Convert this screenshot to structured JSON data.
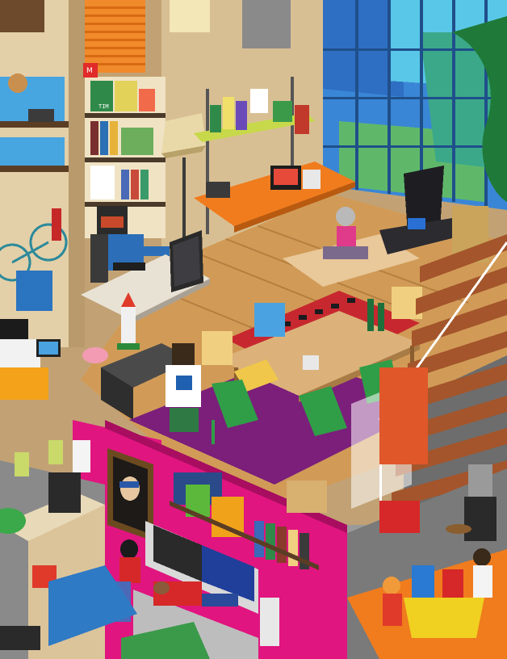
{
  "scene": {
    "description_kind": "isometric pixel-art loft interior",
    "palette": {
      "wall_beige": "#d8bf93",
      "wall_tan": "#c2a274",
      "floor_wood": "#d19b57",
      "floor_wood_dark": "#b57f40",
      "window_blue": "#3a86d6",
      "window_cyan": "#59c7e8",
      "window_green": "#5fb86a",
      "magenta_wall": "#e0157f",
      "magenta_dark": "#a80d60",
      "purple_rug": "#7b1f7a",
      "red_rug": "#c7282f",
      "table_wood": "#dcb27a",
      "green_chair": "#2f9e47",
      "orange_desk": "#f07c1e",
      "stair_wood": "#a4552b",
      "black": "#1b1b1f"
    },
    "book_spines": {
      "spine_1": "TIM",
      "spine_2": "M"
    }
  }
}
